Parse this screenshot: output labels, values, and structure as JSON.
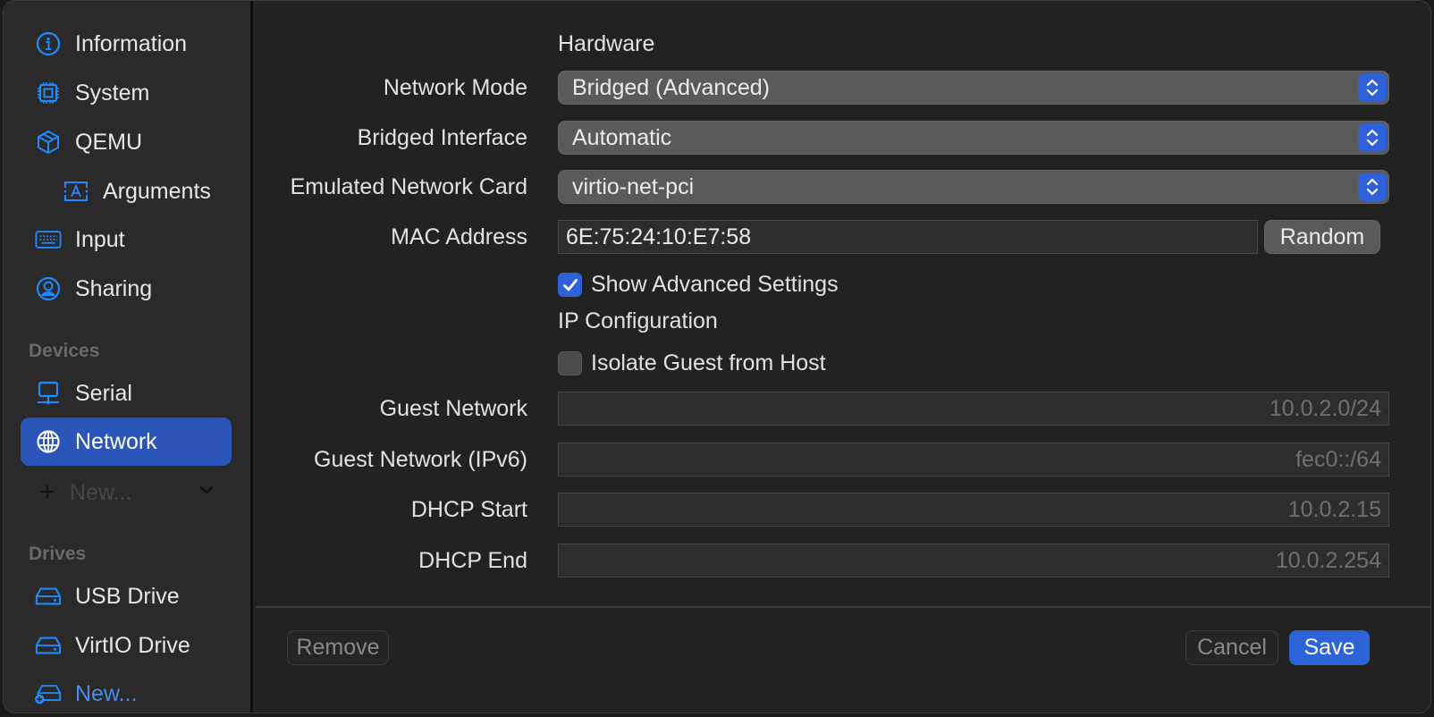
{
  "sidebar": {
    "items": [
      {
        "label": "Information",
        "icon": "info-circle-icon"
      },
      {
        "label": "System",
        "icon": "cpu-chip-icon"
      },
      {
        "label": "QEMU",
        "icon": "cube-icon"
      },
      {
        "label": "Arguments",
        "icon": "text-cursor-icon"
      },
      {
        "label": "Input",
        "icon": "keyboard-icon"
      },
      {
        "label": "Sharing",
        "icon": "person-circle-icon"
      }
    ],
    "devices_header": "Devices",
    "devices": [
      {
        "label": "Serial",
        "icon": "serial-monitor-icon"
      },
      {
        "label": "Network",
        "icon": "globe-network-icon",
        "selected": true
      }
    ],
    "devices_new": "New...",
    "drives_header": "Drives",
    "drives": [
      {
        "label": "USB Drive",
        "icon": "drive-icon"
      },
      {
        "label": "VirtIO Drive",
        "icon": "drive-icon"
      }
    ],
    "drives_new": "New..."
  },
  "form": {
    "hardware_title": "Hardware",
    "network_mode": {
      "label": "Network Mode",
      "value": "Bridged (Advanced)"
    },
    "bridged_interface": {
      "label": "Bridged Interface",
      "value": "Automatic"
    },
    "emulated_card": {
      "label": "Emulated Network Card",
      "value": "virtio-net-pci"
    },
    "mac_address": {
      "label": "MAC Address",
      "value": "6E:75:24:10:E7:58"
    },
    "random_label": "Random",
    "show_advanced": {
      "label": "Show Advanced Settings",
      "checked": true
    },
    "ip_config_title": "IP Configuration",
    "isolate_guest": {
      "label": "Isolate Guest from Host",
      "checked": false
    },
    "guest_network": {
      "label": "Guest Network",
      "placeholder": "10.0.2.0/24"
    },
    "guest_network_ipv6": {
      "label": "Guest Network (IPv6)",
      "placeholder": "fec0::/64"
    },
    "dhcp_start": {
      "label": "DHCP Start",
      "placeholder": "10.0.2.15"
    },
    "dhcp_end": {
      "label": "DHCP End",
      "placeholder": "10.0.2.254"
    }
  },
  "footer": {
    "remove_label": "Remove",
    "cancel_label": "Cancel",
    "save_label": "Save"
  },
  "colors": {
    "accent": "#2c63d6",
    "selection": "#2b55b9",
    "icon_blue": "#1f8bff"
  }
}
